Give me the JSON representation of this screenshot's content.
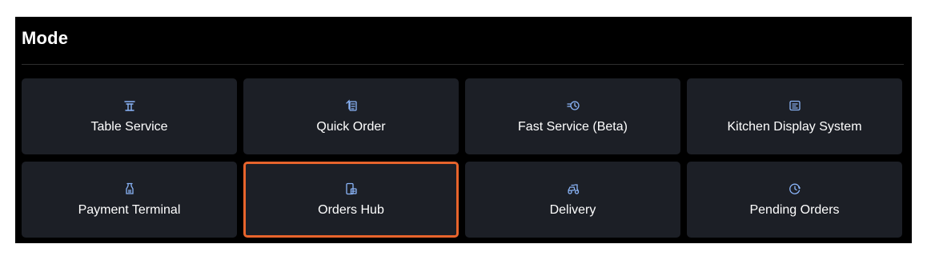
{
  "mode": {
    "title": "Mode",
    "accent_color": "#e8642c",
    "tiles": [
      {
        "label": "Table Service",
        "icon": "table-icon"
      },
      {
        "label": "Quick Order",
        "icon": "quick-order-icon"
      },
      {
        "label": "Fast Service (Beta)",
        "icon": "fast-service-icon"
      },
      {
        "label": "Kitchen Display System",
        "icon": "kitchen-display-icon"
      },
      {
        "label": "Payment Terminal",
        "icon": "payment-terminal-icon"
      },
      {
        "label": "Orders Hub",
        "icon": "orders-hub-icon",
        "selected": true
      },
      {
        "label": "Delivery",
        "icon": "delivery-icon"
      },
      {
        "label": "Pending Orders",
        "icon": "pending-orders-icon"
      }
    ]
  }
}
